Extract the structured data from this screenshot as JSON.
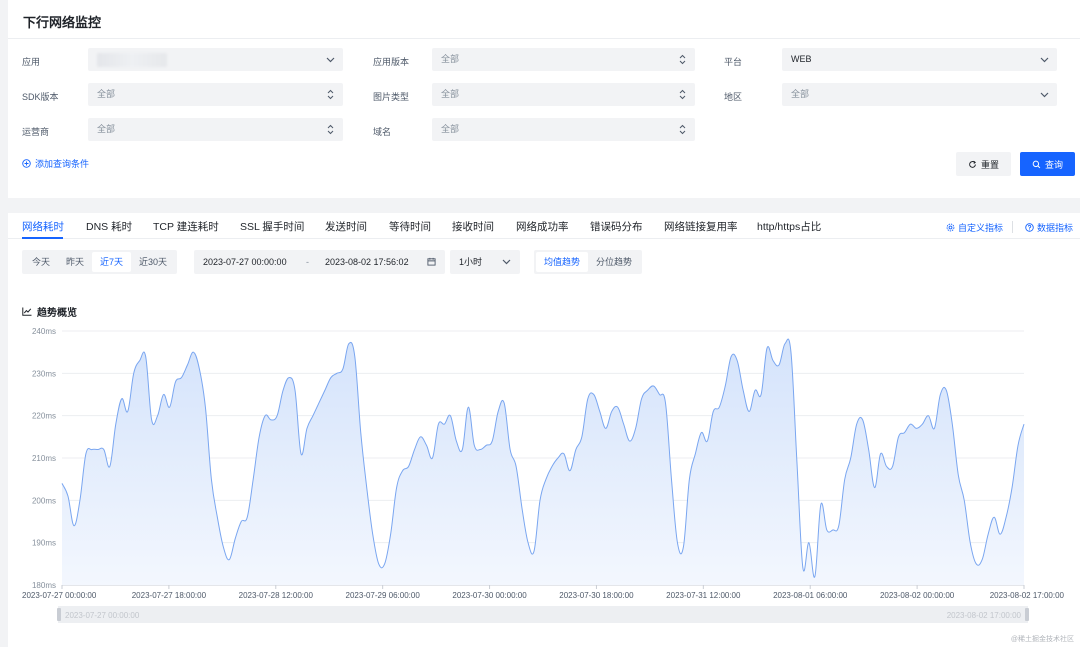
{
  "page": {
    "title": "下行网络监控"
  },
  "filters": {
    "app": {
      "label": "应用",
      "value": ""
    },
    "app_version": {
      "label": "应用版本",
      "value": "全部"
    },
    "platform": {
      "label": "平台",
      "value": "WEB"
    },
    "sdk_version": {
      "label": "SDK版本",
      "value": "全部"
    },
    "image_type": {
      "label": "图片类型",
      "value": "全部"
    },
    "region": {
      "label": "地区",
      "value": "全部"
    },
    "carrier": {
      "label": "运营商",
      "value": "全部"
    },
    "domain": {
      "label": "域名",
      "value": "全部"
    },
    "add_condition": "添加查询条件",
    "reset": "重置",
    "query": "查询"
  },
  "tabs": [
    {
      "label": "网络耗时",
      "active": true
    },
    {
      "label": "DNS 耗时"
    },
    {
      "label": "TCP 建连耗时"
    },
    {
      "label": "SSL 握手时间"
    },
    {
      "label": "发送时间"
    },
    {
      "label": "等待时间"
    },
    {
      "label": "接收时间"
    },
    {
      "label": "网络成功率"
    },
    {
      "label": "错误码分布"
    },
    {
      "label": "网络链接复用率"
    },
    {
      "label": "http/https占比"
    }
  ],
  "tab_links": {
    "custom_metric": "自定义指标",
    "data_metric": "数据指标"
  },
  "time_range": {
    "quick": [
      "今天",
      "昨天",
      "近7天",
      "近30天"
    ],
    "active_quick": "近7天",
    "start": "2023-07-27 00:00:00",
    "separator": "-",
    "end": "2023-08-02 17:56:02",
    "interval": "1小时"
  },
  "view_mode": {
    "options": [
      "均值趋势",
      "分位趋势"
    ],
    "active": "均值趋势"
  },
  "section_title": "趋势概览",
  "colors": {
    "accent": "#1664ff",
    "line": "#7aa6f0",
    "area_top": "#d4e3fb",
    "area_bottom": "#f3f7fe"
  },
  "chart_data": {
    "type": "area",
    "ylim": [
      180,
      240
    ],
    "y_ticks": [
      "240ms",
      "230ms",
      "220ms",
      "210ms",
      "200ms",
      "190ms",
      "180ms"
    ],
    "x_ticks": [
      "2023-07-27 00:00:00",
      "2023-07-27 18:00:00",
      "2023-07-28 12:00:00",
      "2023-07-29 06:00:00",
      "2023-07-30 00:00:00",
      "2023-07-30 18:00:00",
      "2023-07-31 12:00:00",
      "2023-08-01 06:00:00",
      "2023-08-02 00:00:00",
      "2023-08-02 17:00:00"
    ],
    "x_hours": [
      0,
      1,
      2,
      3,
      4,
      5,
      6,
      7,
      8,
      9,
      10,
      11,
      12,
      13,
      14,
      15,
      16,
      17,
      18,
      19,
      20,
      21,
      22,
      23,
      24,
      25,
      26,
      27,
      28,
      29,
      30,
      31,
      32,
      33,
      34,
      35,
      36,
      37,
      38,
      39,
      40,
      41,
      42,
      43,
      44,
      45,
      46,
      47,
      48,
      49,
      50,
      51,
      52,
      53,
      54,
      55,
      56,
      57,
      58,
      59,
      60,
      61,
      62,
      63,
      64,
      65,
      66,
      67,
      68,
      69,
      70,
      71,
      72,
      73,
      74,
      75,
      76,
      77,
      78,
      79,
      80,
      81,
      82,
      83,
      84,
      85,
      86,
      87,
      88,
      89,
      90,
      91,
      92,
      93,
      94,
      95,
      96,
      97,
      98,
      99,
      100,
      101,
      102,
      103,
      104,
      105,
      106,
      107,
      108,
      109,
      110,
      111,
      112,
      113,
      114,
      115,
      116,
      117,
      118,
      119,
      120,
      121,
      122,
      123,
      124,
      125,
      126,
      127,
      128,
      129,
      130,
      131,
      132,
      133,
      134,
      135,
      136,
      137,
      138,
      139,
      140,
      141,
      142,
      143,
      144,
      145,
      146,
      147,
      148,
      149,
      150,
      151,
      152,
      153,
      154,
      155,
      156,
      157,
      158,
      159,
      160,
      161
    ],
    "values": [
      204,
      201,
      194,
      200,
      211,
      212,
      212,
      212,
      208,
      218,
      224,
      221,
      230,
      233,
      234,
      219,
      220,
      225,
      222,
      228,
      229,
      232,
      235,
      231,
      222,
      205,
      196,
      189,
      186,
      191,
      195,
      196,
      205,
      215,
      220,
      219,
      220,
      226,
      229,
      226,
      211,
      217,
      220,
      223,
      226,
      229,
      230,
      231,
      237,
      234,
      216,
      203,
      192,
      185,
      185,
      192,
      203,
      207,
      208,
      212,
      215,
      213,
      210,
      218,
      218,
      220,
      214,
      212,
      222,
      213,
      212,
      213,
      214,
      221,
      223,
      212,
      208,
      198,
      190,
      188,
      200,
      205,
      208,
      210,
      211,
      207,
      212,
      215,
      224,
      225,
      221,
      217,
      221,
      222,
      218,
      214,
      217,
      224,
      226,
      227,
      225,
      223,
      205,
      190,
      189,
      205,
      211,
      216,
      214,
      221,
      222,
      227,
      234,
      233,
      226,
      221,
      226,
      225,
      236,
      233,
      232,
      237,
      235,
      209,
      184,
      190,
      182,
      199,
      193,
      193,
      194,
      205,
      210,
      218,
      219,
      212,
      203,
      211,
      208,
      208,
      215,
      216,
      218,
      217,
      218,
      220,
      217,
      225,
      226,
      218,
      206,
      200,
      190,
      185,
      186,
      192,
      196,
      192,
      196,
      203,
      213,
      218,
      214,
      212,
      209,
      214,
      215,
      215,
      207,
      201,
      209,
      211,
      213,
      214
    ]
  },
  "slider": {
    "start": "2023-07-27 00:00:00",
    "end": "2023-08-02 17:00:00"
  },
  "watermark": "@稀土掘金技术社区"
}
